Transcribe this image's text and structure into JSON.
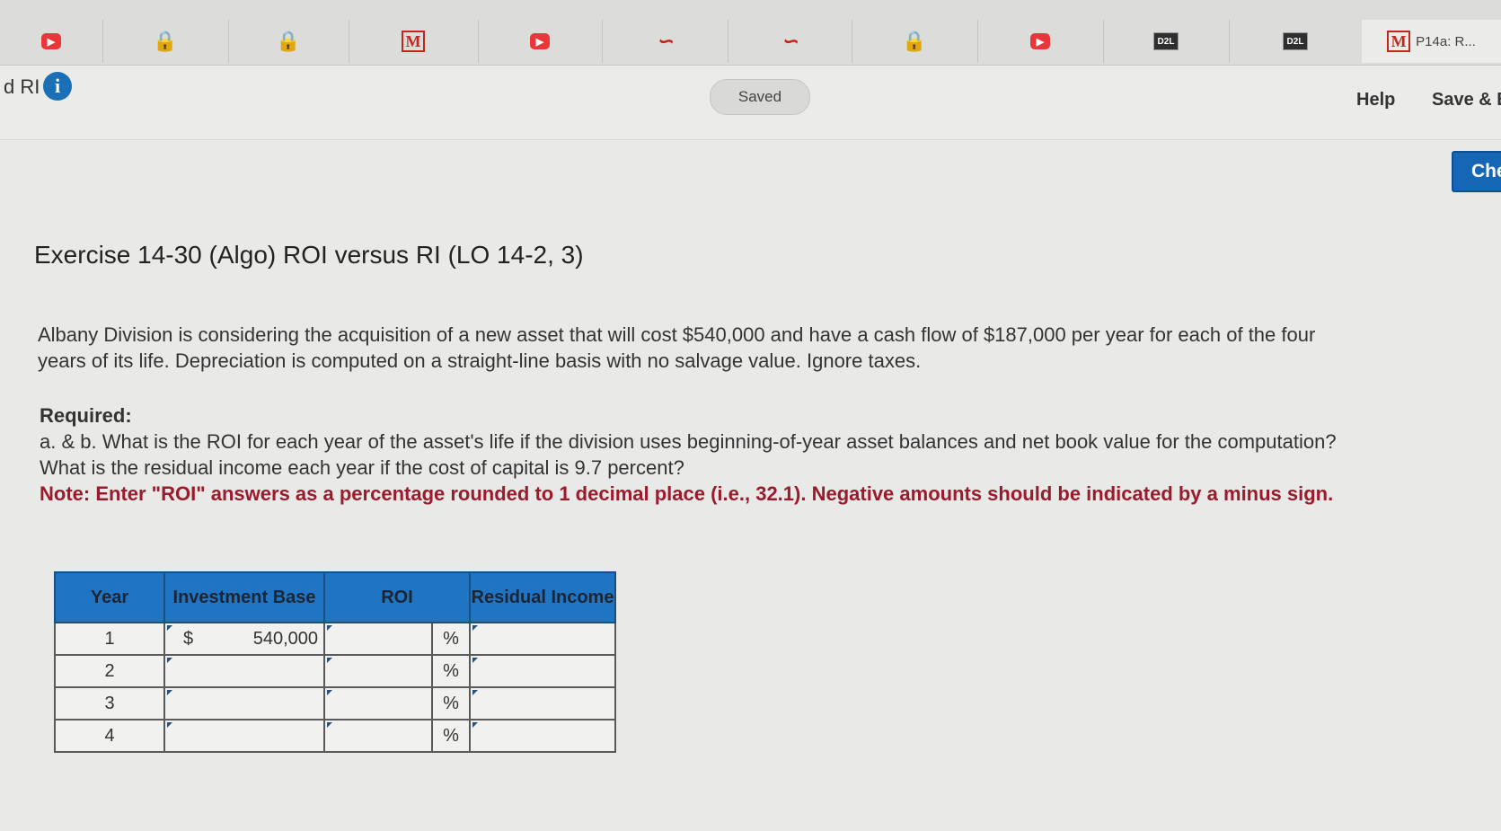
{
  "tabs": [
    {
      "icon": "red-play-icon",
      "title": ""
    },
    {
      "icon": "lock-icon",
      "title": ""
    },
    {
      "icon": "lock-icon",
      "title": ""
    },
    {
      "icon": "m-icon",
      "title": ""
    },
    {
      "icon": "red-play-icon",
      "title": ""
    },
    {
      "icon": "s-icon",
      "title": ""
    },
    {
      "icon": "s-icon",
      "title": ""
    },
    {
      "icon": "lock-icon",
      "title": ""
    },
    {
      "icon": "red-play-icon",
      "title": ""
    },
    {
      "icon": "d2l-icon",
      "title": ""
    },
    {
      "icon": "d2l-icon",
      "title": ""
    },
    {
      "icon": "m-icon",
      "title": "P14a: R..."
    }
  ],
  "tab_glyphs": {
    "m": "M",
    "d2l": "D2L",
    "lock": "🔒",
    "s": "∽",
    "play": "▶"
  },
  "header": {
    "crumb": "d RI",
    "info_glyph": "i",
    "saved": "Saved",
    "help": "Help",
    "save_exit": "Save & E",
    "check": "Che"
  },
  "question": {
    "title": "Exercise 14-30 (Algo) ROI versus RI (LO 14-2, 3)",
    "body": "Albany Division is considering the acquisition of a new asset that will cost $540,000 and have a cash flow of $187,000 per year for each of the four years of its life. Depreciation is computed on a straight-line basis with no salvage value. Ignore taxes.",
    "required_label": "Required:",
    "required_text": "a. & b. What is the ROI for each year of the asset's life if the division uses beginning-of-year asset balances and net book value for the computation? What is the residual income each year if the cost of capital is 9.7 percent?",
    "note": "Note: Enter \"ROI\" answers as a percentage rounded to 1 decimal place (i.e., 32.1). Negative amounts should be indicated by a minus sign."
  },
  "table": {
    "headers": {
      "year": "Year",
      "investment": "Investment Base",
      "roi": "ROI",
      "ri": "Residual Income"
    },
    "currency": "$",
    "pct": "%",
    "rows": [
      {
        "year": "1",
        "investment": "540,000",
        "roi": "",
        "ri": ""
      },
      {
        "year": "2",
        "investment": "",
        "roi": "",
        "ri": ""
      },
      {
        "year": "3",
        "investment": "",
        "roi": "",
        "ri": ""
      },
      {
        "year": "4",
        "investment": "",
        "roi": "",
        "ri": ""
      }
    ]
  }
}
